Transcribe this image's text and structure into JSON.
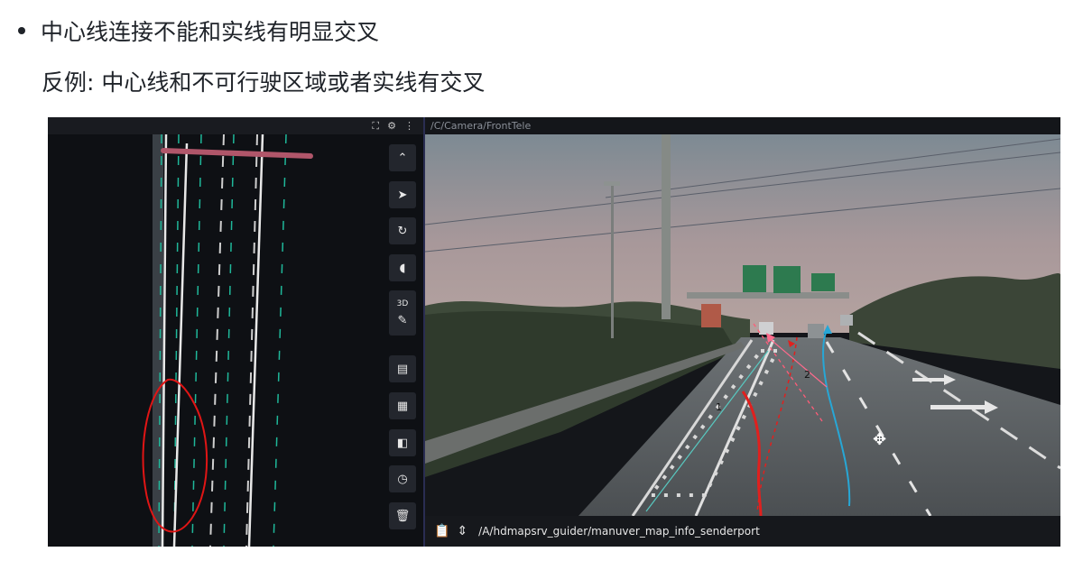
{
  "bullet": {
    "text": "中心线连接不能和实线有明显交叉"
  },
  "counterexample": {
    "text": "反例: 中心线和不可行驶区域或者实线有交叉"
  },
  "screenshot": {
    "left_panel": {
      "header_icons": [
        "fullscreen-icon",
        "gear-icon",
        "more-icon"
      ],
      "toolbar": [
        {
          "name": "collapse-up-button",
          "glyph": "⌃"
        },
        {
          "name": "select-pointer-button",
          "glyph": "➤"
        },
        {
          "name": "reset-rotate-button",
          "glyph": "↻"
        },
        {
          "name": "mouse-mode-button",
          "glyph": "◖"
        },
        {
          "name": "view-3d-button",
          "glyph": "3D"
        },
        {
          "name": "measure-ruler-button",
          "glyph": "✎"
        },
        {
          "name": "map-button",
          "glyph": "▤"
        },
        {
          "name": "grid-button",
          "glyph": "▦"
        },
        {
          "name": "split-view-button",
          "glyph": "◧"
        },
        {
          "name": "history-clock-button",
          "glyph": "◷"
        },
        {
          "name": "delete-trash-button",
          "glyph": "🗑"
        }
      ]
    },
    "right_panel": {
      "camera_topic": "/C/Camera/FrontTele",
      "overlay_labels": [
        "1",
        "2"
      ],
      "bottom_topic": "/A/hdmapsrv_guider/manuver_map_info_senderport"
    }
  }
}
